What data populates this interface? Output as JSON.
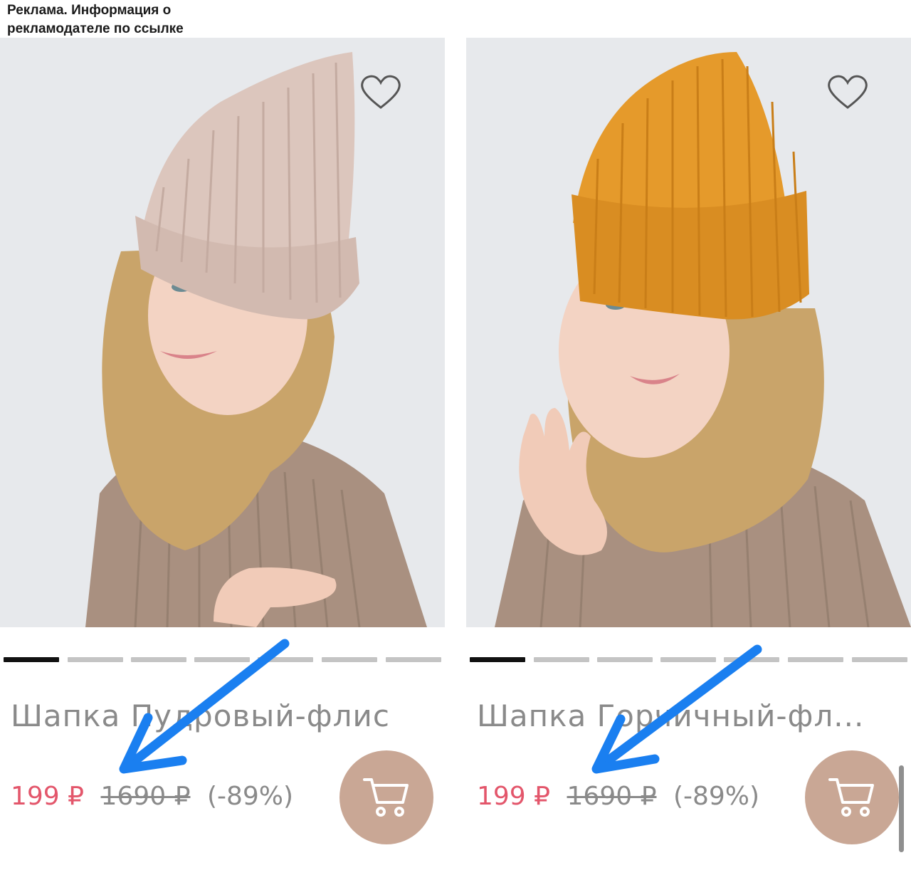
{
  "ad": {
    "line1": "Реклама. Информация о",
    "line2": "рекламодателе по ссылке"
  },
  "products": [
    {
      "title": "Шапка Пудровый-флис",
      "hat_color": "#dcc6bd",
      "price": "199 ₽",
      "old_price": "1690 ₽",
      "discount": "(-89%)",
      "favorite_icon": "heart-outline-icon",
      "cart_icon": "shopping-cart-icon",
      "image_pages": 7,
      "active_image": 1
    },
    {
      "title": "Шапка Горчичный-фл...",
      "hat_color": "#e59a2b",
      "price": "199 ₽",
      "old_price": "1690 ₽",
      "discount": "(-89%)",
      "favorite_icon": "heart-outline-icon",
      "cart_icon": "shopping-cart-icon",
      "image_pages": 7,
      "active_image": 1
    }
  ],
  "colors": {
    "price": "#e3566b",
    "muted_text": "#8a8a8a",
    "cart_button": "#c9a795",
    "annotation_arrow": "#1a7ff0",
    "photo_background": "#e7e9ec"
  }
}
